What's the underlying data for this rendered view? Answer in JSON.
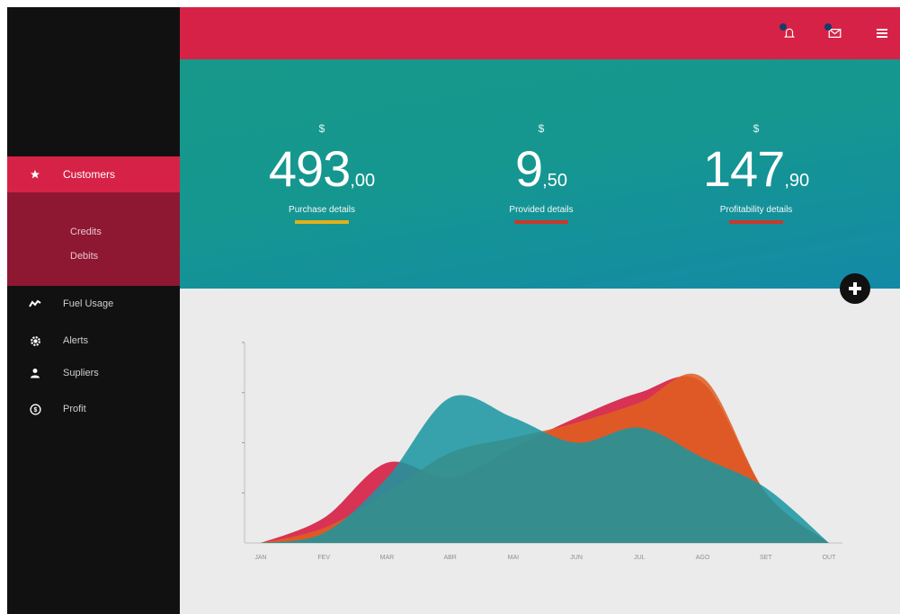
{
  "sidebar": {
    "active": {
      "label": "Customers",
      "icon": "star-icon"
    },
    "sub_items": [
      {
        "label": "Credits"
      },
      {
        "label": "Debits"
      }
    ],
    "items": [
      {
        "label": "Fuel Usage",
        "icon": "trend-icon"
      },
      {
        "label": "Alerts",
        "icon": "gear-icon"
      },
      {
        "label": "Supliers",
        "icon": "user-icon"
      },
      {
        "label": "Profit",
        "icon": "dollar-circle-icon"
      }
    ]
  },
  "topbar": {
    "icons": [
      "notification-icon",
      "mail-icon",
      "menu-icon"
    ],
    "color": "#d62246"
  },
  "stats": [
    {
      "currency": "$",
      "integer": "493",
      "decimal": ",00",
      "label": "Purchase details",
      "bar_color": "#e2b11a"
    },
    {
      "currency": "$",
      "integer": "9",
      "decimal": ",50",
      "label": "Provided details",
      "bar_color": "#c8392b"
    },
    {
      "currency": "$",
      "integer": "147",
      "decimal": ",90",
      "label": "Profitability details",
      "bar_color": "#c8392b"
    }
  ],
  "chart_data": {
    "type": "area",
    "categories": [
      "JAN",
      "FEV",
      "MAR",
      "ABR",
      "MAI",
      "JUN",
      "JUL",
      "AGO",
      "SET",
      "OUT"
    ],
    "ylim": [
      0,
      4
    ],
    "series": [
      {
        "color": "#d62246",
        "values": [
          0,
          0.5,
          1.6,
          1.3,
          1.9,
          2.5,
          3.0,
          3.2,
          1.0,
          0
        ]
      },
      {
        "color": "#e0601f",
        "values": [
          0,
          0.3,
          1.0,
          1.8,
          2.1,
          2.4,
          2.8,
          3.3,
          1.0,
          0
        ]
      },
      {
        "color": "#1a96a0",
        "values": [
          0,
          0.2,
          1.3,
          2.9,
          2.5,
          2.0,
          2.3,
          1.7,
          1.1,
          0
        ]
      }
    ]
  }
}
